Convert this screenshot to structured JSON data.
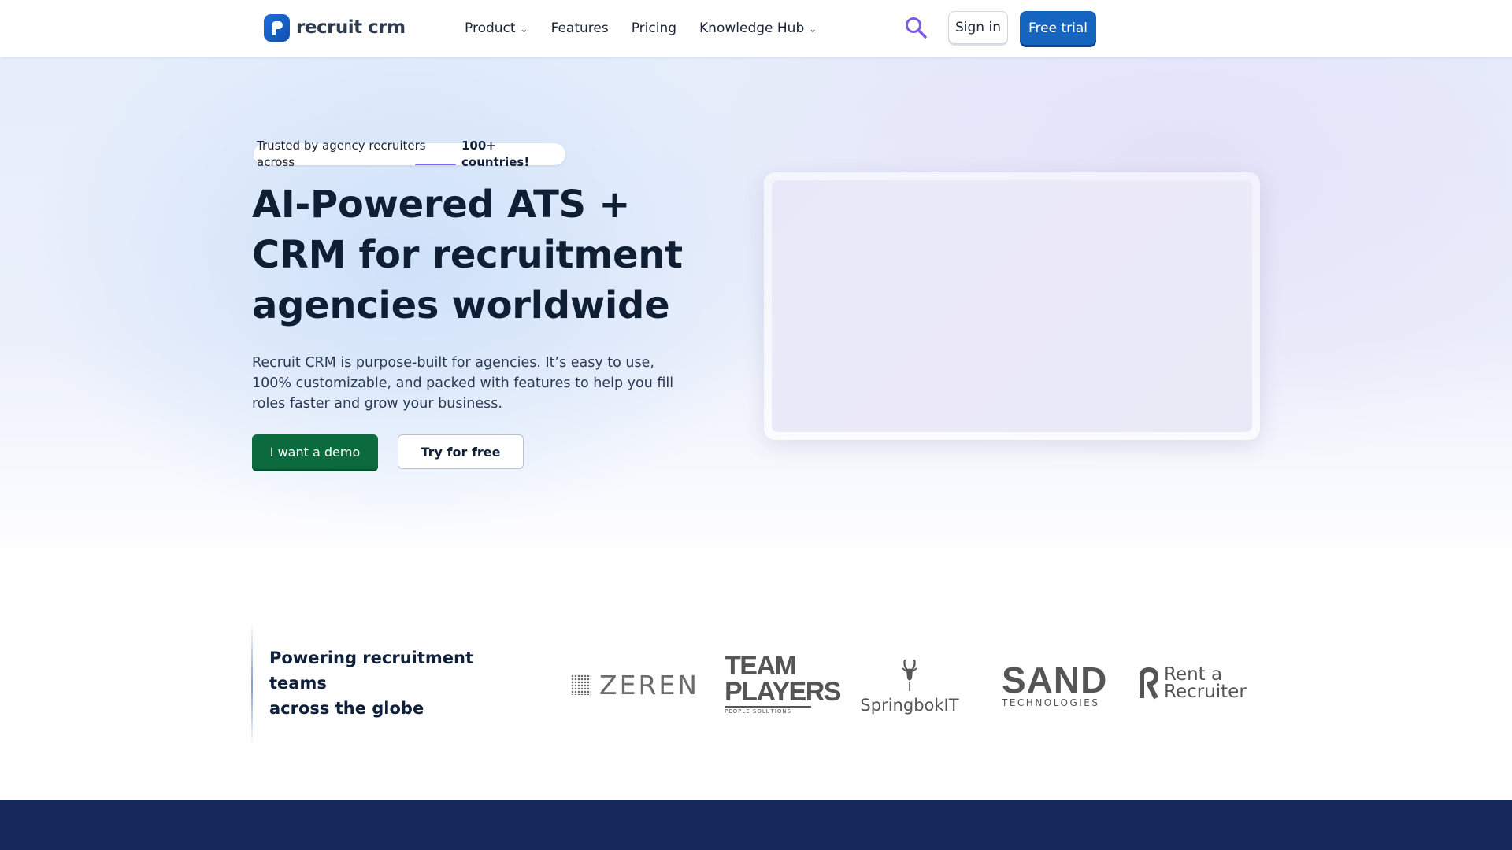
{
  "header": {
    "logo_text": "recruit crm",
    "nav": [
      {
        "label": "Product",
        "has_dropdown": true
      },
      {
        "label": "Features",
        "has_dropdown": false
      },
      {
        "label": "Pricing",
        "has_dropdown": false
      },
      {
        "label": "Knowledge Hub",
        "has_dropdown": true
      }
    ],
    "search_icon": "search-icon",
    "signin_label": "Sign in",
    "trial_label": "Free trial"
  },
  "hero": {
    "trust_text": "Trusted by agency recruiters across",
    "trust_count": "100+ countries!",
    "title": "AI-Powered ATS + CRM for recruitment agencies worldwide",
    "description": "Recruit CRM is purpose-built for agencies. It’s easy to use, 100% customizable, and packed with features to help you fill roles faster and grow your business.",
    "demo_label": "I want a demo",
    "tryfree_label": "Try for free"
  },
  "trusted": {
    "heading_line1": "Powering recruitment teams",
    "heading_line2": "across the globe",
    "logos": {
      "zeren": "ZEREN",
      "teamplayers_line1": "TEAM",
      "teamplayers_line2": "PLAYERS",
      "teamplayers_sub": "PEOPLE SOLUTIONS",
      "springbok": "SpringbokIT",
      "sand": "SAND",
      "sand_sub": "TECHNOLOGIES",
      "rentarecruiter_line1": "Rent a",
      "rentarecruiter_line2": "Recruiter"
    }
  },
  "colors": {
    "primary_blue": "#1565c0",
    "demo_green": "#0b6b3f",
    "dark_band": "#17295a",
    "accent_purple": "#7b68ee"
  },
  "footer_band": {
    "heading": ""
  }
}
